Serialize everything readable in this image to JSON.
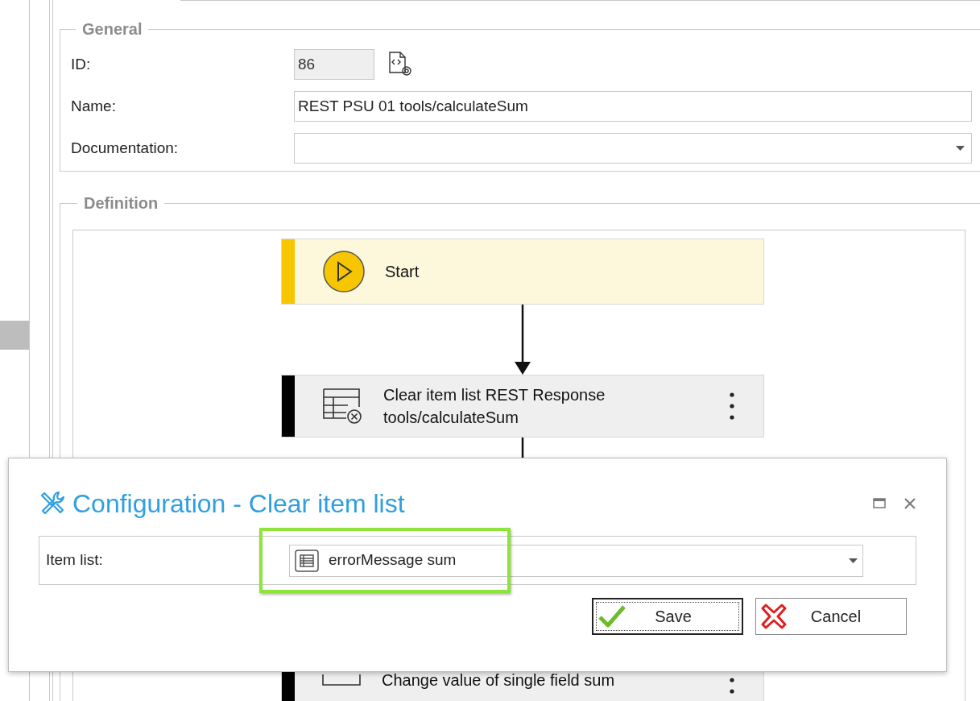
{
  "general": {
    "legend": "General",
    "fields": [
      {
        "kind": "readonly",
        "label": "ID:",
        "value": "86"
      },
      {
        "kind": "text",
        "label": "Name:",
        "value": "REST PSU 01 tools/calculateSum"
      },
      {
        "kind": "dropdown",
        "label": "Documentation:"
      }
    ]
  },
  "definition": {
    "legend": "Definition",
    "nodes": [
      {
        "kind": "start",
        "label": "Start"
      },
      {
        "kind": "clear",
        "label": "Clear item list REST Response tools/calculateSum"
      },
      {
        "kind": "change",
        "label": "Change value of single field sum"
      }
    ]
  },
  "dialog": {
    "title": "Configuration - Clear item list",
    "field_label": "Item list:",
    "value": "errorMessage sum",
    "highlighted": true,
    "buttons": [
      {
        "kind": "save",
        "label": "Save",
        "focused": true
      },
      {
        "kind": "cancel",
        "label": "Cancel",
        "focused": false
      }
    ]
  }
}
